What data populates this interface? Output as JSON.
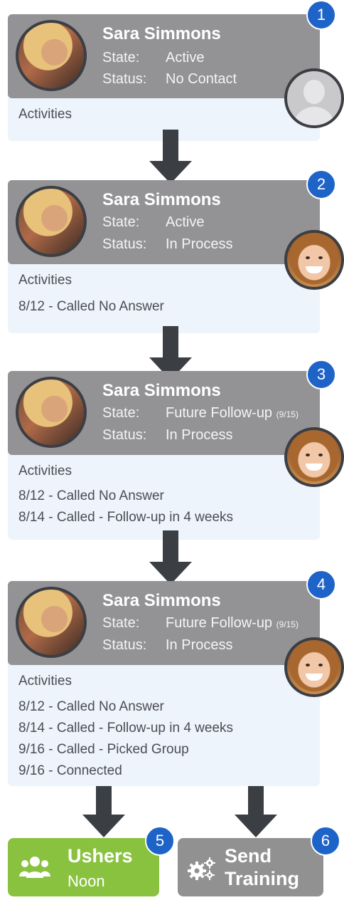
{
  "cards": [
    {
      "step": "1",
      "name": "Sara Simmons",
      "state_label": "State:",
      "state_value": "Active",
      "state_note": "",
      "status_label": "Status:",
      "status_value": "No Contact",
      "activities_title": "Activities",
      "activities": [],
      "avatar": "placeholder-user-icon"
    },
    {
      "step": "2",
      "name": "Sara Simmons",
      "state_label": "State:",
      "state_value": "Active",
      "state_note": "",
      "status_label": "Status:",
      "status_value": "In Process",
      "activities_title": "Activities",
      "activities": [
        "8/12 - Called No Answer"
      ],
      "avatar": "caller-photo"
    },
    {
      "step": "3",
      "name": "Sara Simmons",
      "state_label": "State:",
      "state_value": "Future Follow-up",
      "state_note": "(9/15)",
      "status_label": "Status:",
      "status_value": "In Process",
      "activities_title": "Activities",
      "activities": [
        "8/12 - Called No Answer",
        "8/14 - Called - Follow-up in 4 weeks"
      ],
      "avatar": "caller-photo"
    },
    {
      "step": "4",
      "name": "Sara Simmons",
      "state_label": "State:",
      "state_value": "Future Follow-up",
      "state_note": "(9/15)",
      "status_label": "Status:",
      "status_value": "In Process",
      "activities_title": "Activities",
      "activities": [
        "8/12 - Called No Answer",
        "8/14 - Called - Follow-up in 4 weeks",
        "9/16 - Called - Picked Group",
        "9/16 - Connected"
      ],
      "avatar": "caller-photo"
    }
  ],
  "outcomes": {
    "ushers": {
      "step": "5",
      "title": "Ushers",
      "subtitle": "Noon",
      "icon": "group-icon",
      "color": "#89c23f"
    },
    "send_training": {
      "step": "6",
      "title_line1": "Send",
      "title_line2": "Training",
      "icon": "gears-icon",
      "color": "#919191"
    }
  },
  "colors": {
    "card_header": "#939396",
    "card_body": "#eef4fb",
    "badge": "#1e63c8",
    "arrow": "#3b3e43"
  }
}
